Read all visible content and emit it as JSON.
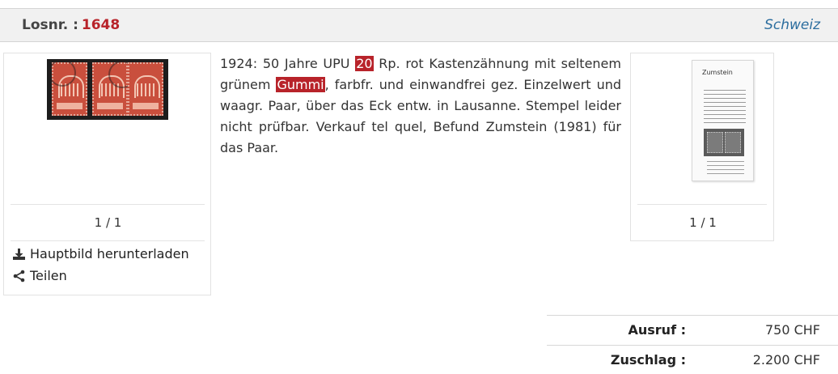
{
  "header": {
    "lot_label": "Losnr. :",
    "lot_number": "1648",
    "country": "Schweiz"
  },
  "main_image": {
    "counter": "1 / 1",
    "download_label": "Hauptbild herunterladen",
    "share_label": "Teilen",
    "icons": [
      "download-icon",
      "share-icon"
    ]
  },
  "description": {
    "p1": "1924: 50 Jahre UPU ",
    "highlight1": "20",
    "p2": " Rp. rot Kastenzähnung mit seltenem grünem ",
    "highlight2": "Gummi",
    "p3": ", farbfr. und einwandfrei gez. Einzelwert und waagr. Paar, über das Eck entw. in Lausanne. Stempel leider nicht prüfbar. Verkauf tel quel, Befund Zumstein (1981) für das Paar."
  },
  "certificate": {
    "counter": "1 / 1",
    "header_text": "Zumstein"
  },
  "prices": {
    "start_label": "Ausruf :",
    "start_value": "750 CHF",
    "hammer_label": "Zuschlag :",
    "hammer_value": "2.200 CHF"
  },
  "colors": {
    "accent": "#b8232a",
    "link": "#2b6d9e",
    "header_bg": "#f1f1f1"
  }
}
